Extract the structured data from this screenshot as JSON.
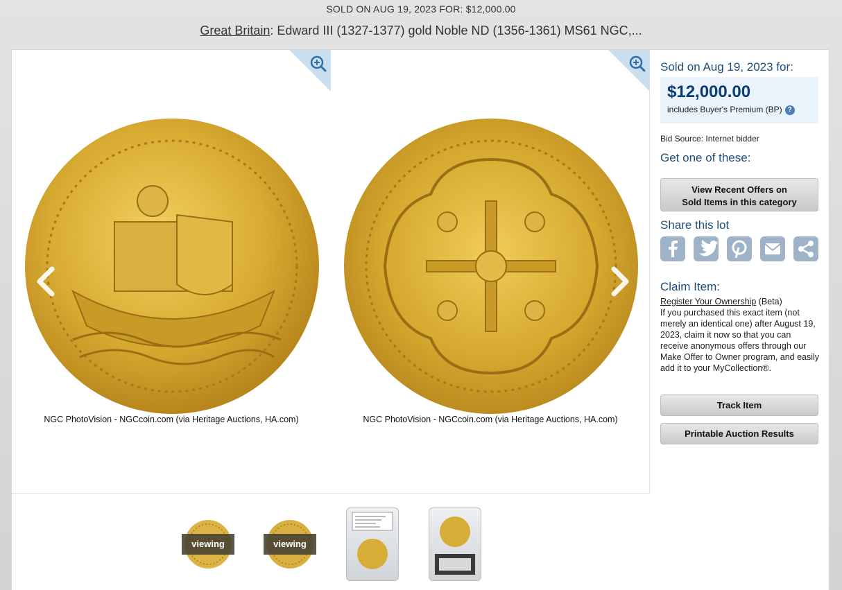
{
  "header": {
    "sold_line": "SOLD ON AUG 19, 2023 FOR: $12,000.00",
    "category_link": "Great Britain",
    "title_rest": ": Edward III (1327-1377) gold Noble ND (1356-1361) MS61 NGC,..."
  },
  "viewer": {
    "left_caption": "NGC PhotoVision - NGCcoin.com (via Heritage Auctions, HA.com)",
    "right_caption": "NGC PhotoVision - NGCcoin.com (via Heritage Auctions, HA.com)",
    "zoom_icon": "zoom-in-icon",
    "prev_icon": "chevron-left-icon",
    "next_icon": "chevron-right-icon"
  },
  "thumbnails": [
    {
      "label": "viewing",
      "kind": "coin-obverse"
    },
    {
      "label": "viewing",
      "kind": "coin-reverse"
    },
    {
      "label": "",
      "kind": "slab-front"
    },
    {
      "label": "",
      "kind": "slab-back"
    }
  ],
  "sidebar": {
    "sold_on": "Sold on Aug 19, 2023 for:",
    "price": "$12,000.00",
    "premium_note": "includes Buyer's Premium (BP)",
    "help_glyph": "?",
    "bid_source": "Bid Source: Internet bidder",
    "get_one": "Get one of these:",
    "offers_button_line1": "View Recent Offers on",
    "offers_button_line2": "Sold Items in this category",
    "share_title": "Share this lot",
    "share_icons": [
      "facebook-icon",
      "twitter-icon",
      "pinterest-icon",
      "email-icon",
      "share-icon"
    ],
    "claim_title": "Claim Item:",
    "register_link": "Register Your Ownership",
    "beta": " (Beta)",
    "claim_body": "If you purchased this exact item (not merely an identical one) after August 19, 2023, claim it now so that you can receive anonymous offers through our Make Offer to Owner program, and easily add it to your MyCollection®.",
    "track_button": "Track Item",
    "print_button": "Printable Auction Results"
  },
  "colors": {
    "accent_blue": "#1f4e79",
    "price_box": "#eaf3fb",
    "gold": "#d4a72c"
  }
}
